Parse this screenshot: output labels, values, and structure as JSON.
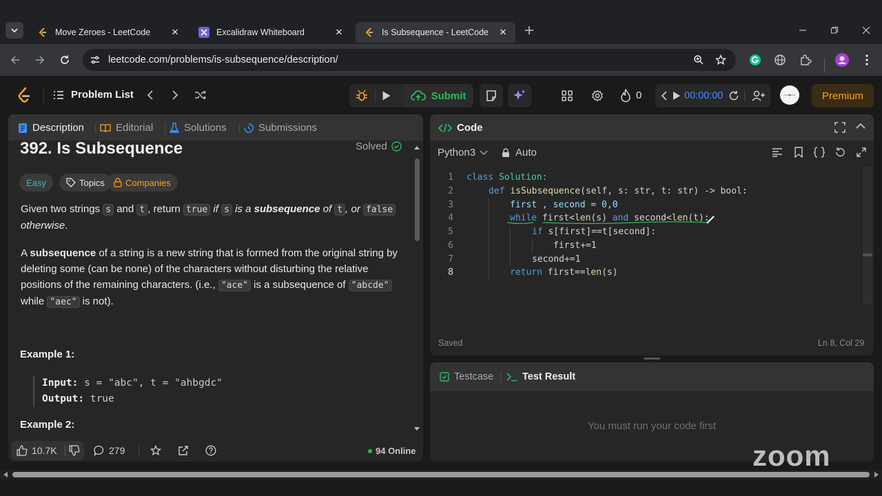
{
  "browser": {
    "tabs": [
      {
        "title": "Move Zeroes - LeetCode",
        "active": false
      },
      {
        "title": "Excalidraw Whiteboard",
        "active": false
      },
      {
        "title": "Is Subsequence - LeetCode",
        "active": true
      }
    ],
    "url": "leetcode.com/problems/is-subsequence/description/"
  },
  "nav": {
    "problem_list": "Problem List",
    "submit": "Submit",
    "streak": "0",
    "timer": "00:00:00",
    "premium": "Premium"
  },
  "left_panel": {
    "tabs": [
      "Description",
      "Editorial",
      "Solutions",
      "Submissions"
    ],
    "title": "392. Is Subsequence",
    "status": "Solved",
    "difficulty": "Easy",
    "topics": "Topics",
    "companies": "Companies",
    "p1": {
      "a": "Given two strings ",
      "s": "s",
      "b": " and ",
      "t": "t",
      "c": ", return ",
      "true": "true",
      "d": " if ",
      "s2": "s",
      "e": " is a ",
      "subseq": "subsequence",
      "f": " of ",
      "t2": "t",
      "g": ", or ",
      "false": "false",
      "h": "otherwise",
      "dot": "."
    },
    "p2": {
      "a": "A ",
      "subseq": "subsequence",
      "b": " of a string is a new string that is formed from the original string by deleting some (can be none) of the characters without disturbing the relative positions of the remaining characters. (i.e., ",
      "ace": "\"ace\"",
      "c": " is a subsequence of ",
      "abcde": "\"abcde\"",
      "d": " while ",
      "aec": "\"aec\"",
      "e": " is not)."
    },
    "example1": {
      "heading": "Example 1:",
      "input_label": "Input:",
      "input": "s = \"abc\", t = \"ahbgdc\"",
      "output_label": "Output:",
      "output": "true"
    },
    "example2": {
      "heading": "Example 2:"
    },
    "footer": {
      "likes": "10.7K",
      "comments": "279",
      "online": "94 Online"
    }
  },
  "code_panel": {
    "title": "Code",
    "language": "Python3",
    "auto": "Auto",
    "status": "Saved",
    "cursor": "Ln 8, Col 29",
    "line_numbers": [
      "1",
      "2",
      "3",
      "4",
      "5",
      "6",
      "7",
      "8"
    ],
    "lines": {
      "l1": {
        "kw": "class",
        "name": " Solution:"
      },
      "l2": {
        "kw": "def",
        "fn": "isSubsequence",
        "rest": "(self, s: str, t: str) -> bool:"
      },
      "l3": "first , second = 0,0",
      "l4": {
        "kw": "while",
        "rest1": " first<",
        "fn1": "len",
        "rest2": "(s) ",
        "kw2": "and",
        "rest3": " second<",
        "fn2": "len",
        "rest4": "(t):"
      },
      "l5": {
        "kw": "if",
        "rest": " s[first]==t[second]:"
      },
      "l6": "first+=1",
      "l7": "second+=1",
      "l8": {
        "kw": "return",
        "rest1": " first==",
        "fn": "len",
        "rest2": "(s)"
      }
    }
  },
  "result_panel": {
    "tabs": [
      "Testcase",
      "Test Result"
    ],
    "message": "You must run your code first"
  },
  "zoom_watermark": "zoom"
}
